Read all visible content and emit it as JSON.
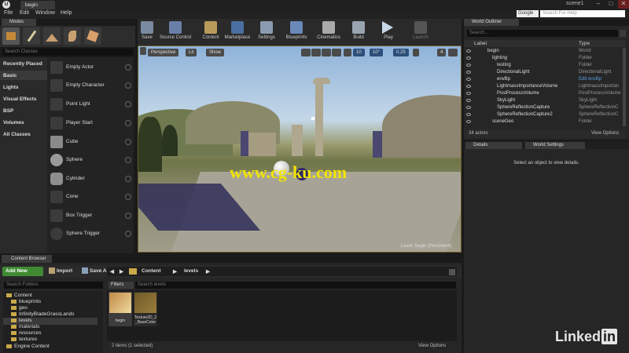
{
  "window": {
    "doc_tab": "begin",
    "project": "scene1",
    "minimize": "–",
    "maximize": "□",
    "close": "✕"
  },
  "menu": [
    "File",
    "Edit",
    "Window",
    "Help"
  ],
  "help_search": {
    "provider": "Google",
    "placeholder": "Search For Help"
  },
  "modes": {
    "tab": "Modes",
    "search_placeholder": "Search Classes",
    "categories": [
      "Recently Placed",
      "Basic",
      "Lights",
      "Visual Effects",
      "BSP",
      "Volumes",
      "All Classes"
    ],
    "selected_category": "Basic",
    "actors": [
      "Empty Actor",
      "Empty Character",
      "Point Light",
      "Player Start",
      "Cube",
      "Sphere",
      "Cylinder",
      "Cone",
      "Box Trigger",
      "Sphere Trigger"
    ]
  },
  "toolbar": {
    "buttons": [
      "Save",
      "Source Control",
      "Content",
      "Marketplace",
      "Settings",
      "Blueprints",
      "Cinematics",
      "Build",
      "Play",
      "Launch"
    ]
  },
  "viewport": {
    "perspective": "Perspective",
    "lit": "Lit",
    "show": "Show",
    "snap_grid": "10",
    "snap_rot": "10°",
    "snap_scale": "0.25",
    "cam_speed": "4",
    "level_label": "Level:  begin (Persistent)",
    "watermark": "www.cg-ku.com"
  },
  "outliner": {
    "tab": "World Outliner",
    "search_placeholder": "Search...",
    "col_label": "Label",
    "col_type": "Type",
    "rows": [
      {
        "label": "begin",
        "type": "World"
      },
      {
        "label": "lighting",
        "type": "Folder"
      },
      {
        "label": "testing",
        "type": "Folder"
      },
      {
        "label": "DirectionalLight",
        "type": "DirectionalLight"
      },
      {
        "label": "envBp",
        "type": "Edit envBp"
      },
      {
        "label": "LightmassImportanceVolume",
        "type": "LightmassImportan"
      },
      {
        "label": "PostProcessVolume",
        "type": "PostProcessVolume"
      },
      {
        "label": "SkyLight",
        "type": "SkyLight"
      },
      {
        "label": "SphereReflectionCapture",
        "type": "SphereReflectionC"
      },
      {
        "label": "SphereReflectionCapture2",
        "type": "SphereReflectionC"
      },
      {
        "label": "sceneGeo",
        "type": "Folder"
      }
    ],
    "count": "34 actors",
    "view_options": "View Options"
  },
  "details": {
    "tab_details": "Details",
    "tab_world": "World Settings",
    "empty_msg": "Select an object to view details."
  },
  "content_browser": {
    "tab": "Content Browser",
    "add_new": "Add New",
    "import": "Import",
    "save_all": "Save All",
    "crumbs": [
      "Content",
      "levels"
    ],
    "search_folders": "Search Folders",
    "filters": "Filters",
    "search_assets": "Search levels",
    "folders": [
      {
        "name": "Content",
        "depth": 0
      },
      {
        "name": "blueprints",
        "depth": 1
      },
      {
        "name": "geo",
        "depth": 1
      },
      {
        "name": "InfinityBladeGrassLands",
        "depth": 1
      },
      {
        "name": "levels",
        "depth": 1
      },
      {
        "name": "materials",
        "depth": 1
      },
      {
        "name": "resources",
        "depth": 1
      },
      {
        "name": "textures",
        "depth": 1
      },
      {
        "name": "Engine Content",
        "depth": 0
      }
    ],
    "assets": [
      {
        "name": "begin"
      },
      {
        "name": "Texture2D_2_BaseColor"
      }
    ],
    "items_count": "2 items (1 selected)",
    "view_options": "View Options"
  },
  "branding": {
    "linked": "Linked",
    "in": "in"
  }
}
